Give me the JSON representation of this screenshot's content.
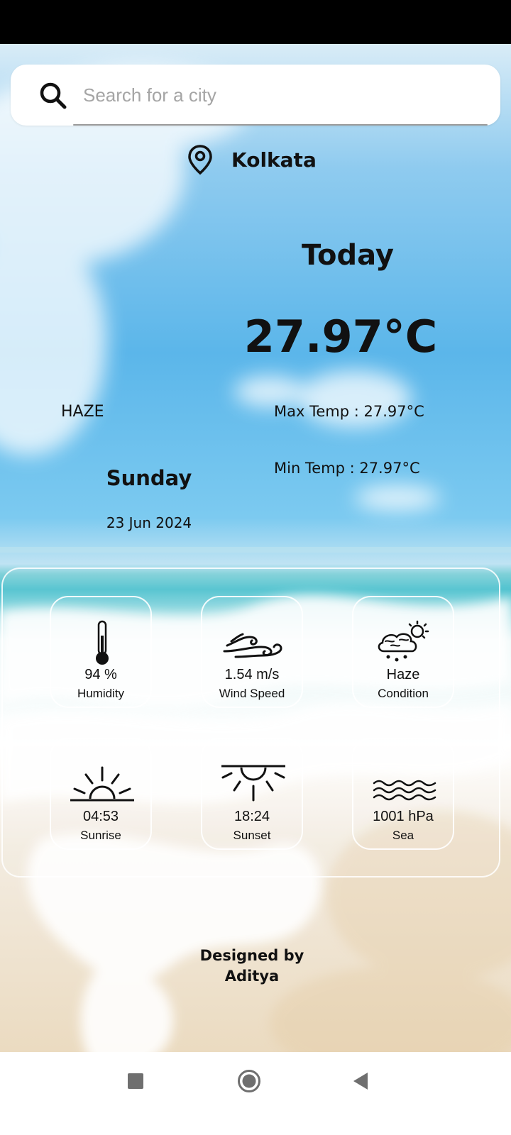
{
  "search": {
    "placeholder": "Search for a city",
    "value": ""
  },
  "location": {
    "city": "Kolkata"
  },
  "today": {
    "label": "Today",
    "temperature": "27.97°C",
    "condition": "HAZE",
    "max_temp": "Max Temp : 27.97°C",
    "min_temp": "Min Temp : 27.97°C",
    "day": "Sunday",
    "date": "23 Jun 2024"
  },
  "details": [
    {
      "value": "94 %",
      "label": "Humidity",
      "icon": "thermometer-icon"
    },
    {
      "value": "1.54 m/s",
      "label": "Wind Speed",
      "icon": "wind-icon"
    },
    {
      "value": "Haze",
      "label": "Condition",
      "icon": "haze-cloud-icon"
    },
    {
      "value": "04:53",
      "label": "Sunrise",
      "icon": "sunrise-icon"
    },
    {
      "value": "18:24",
      "label": "Sunset",
      "icon": "sunset-icon"
    },
    {
      "value": "1001 hPa",
      "label": "Sea",
      "icon": "sea-waves-icon"
    }
  ],
  "footer": {
    "line1": "Designed by",
    "line2": "Aditya"
  },
  "nav": {
    "buttons": [
      "recent-apps",
      "home",
      "back"
    ]
  },
  "colors": {
    "status_bar": "#000000",
    "sky": "#5bb6ea",
    "sea": "#4fc2cf",
    "sand": "#ead9bd",
    "text": "#111111"
  }
}
